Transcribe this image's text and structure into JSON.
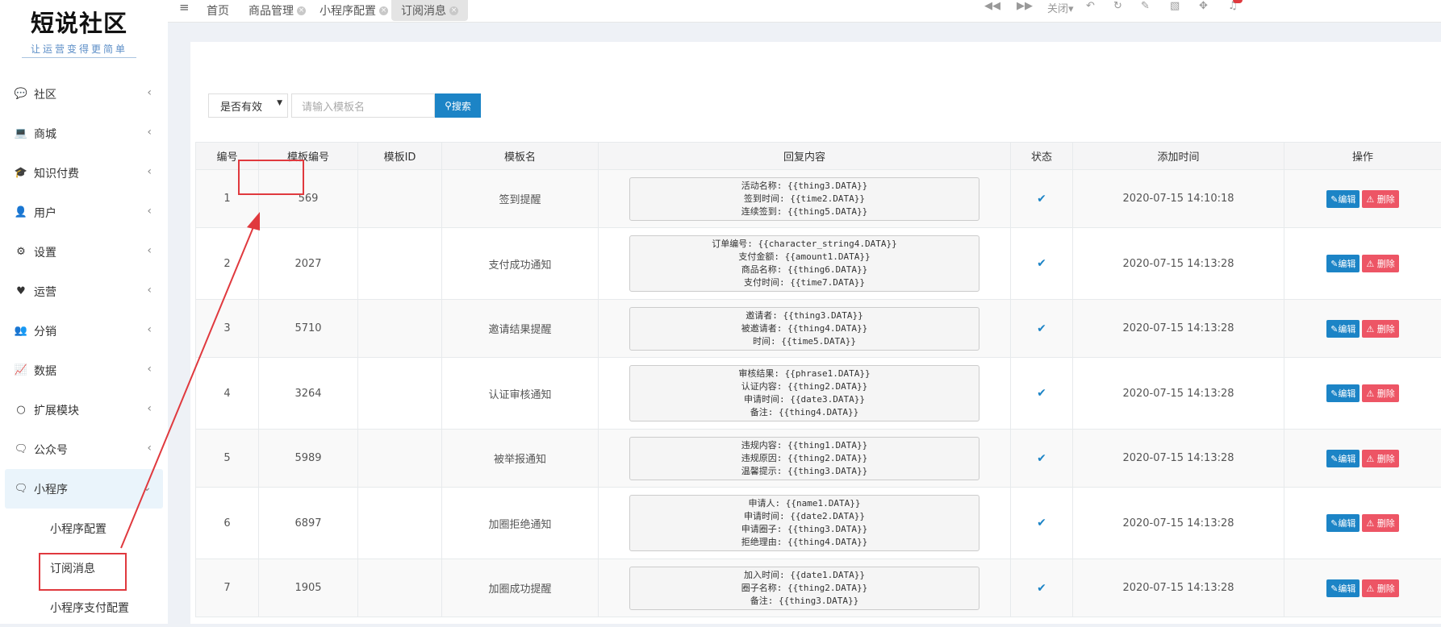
{
  "logo": {
    "title": "短说社区",
    "subtitle": "让运营变得更简单"
  },
  "sidebar": {
    "items": [
      {
        "label": "社区",
        "icon": "chat-icon"
      },
      {
        "label": "商城",
        "icon": "laptop-icon"
      },
      {
        "label": "知识付费",
        "icon": "graduation-cap-icon"
      },
      {
        "label": "用户",
        "icon": "user-icon"
      },
      {
        "label": "设置",
        "icon": "gear-icon"
      },
      {
        "label": "运营",
        "icon": "heartbeat-icon"
      },
      {
        "label": "分销",
        "icon": "users-icon"
      },
      {
        "label": "数据",
        "icon": "line-chart-icon"
      },
      {
        "label": "扩展模块",
        "icon": "puzzle-icon"
      },
      {
        "label": "公众号",
        "icon": "wechat-icon"
      },
      {
        "label": "小程序",
        "icon": "wechat-icon"
      }
    ],
    "submenu": [
      "小程序配置",
      "订阅消息",
      "小程序支付配置"
    ]
  },
  "tabs": [
    {
      "label": "首页"
    },
    {
      "label": "商品管理"
    },
    {
      "label": "小程序配置"
    },
    {
      "label": "订阅消息"
    }
  ],
  "toolbar": {
    "close_label": "关闭"
  },
  "filter": {
    "select_value": "是否有效",
    "search_placeholder": "请输入模板名",
    "search_label": "搜索"
  },
  "table": {
    "headers": [
      "编号",
      "模板编号",
      "模板ID",
      "模板名",
      "回复内容",
      "状态",
      "添加时间",
      "操作"
    ],
    "edit_label": "编辑",
    "delete_label": "删除",
    "rows": [
      {
        "no": "1",
        "code": "569",
        "id": "",
        "name": "签到提醒",
        "reply": [
          "活动名称: {{thing3.DATA}}",
          "签到时间: {{time2.DATA}}",
          "连续签到: {{thing5.DATA}}"
        ],
        "time": "2020-07-15 14:10:18"
      },
      {
        "no": "2",
        "code": "2027",
        "id": "",
        "name": "支付成功通知",
        "reply": [
          "订单编号: {{character_string4.DATA}}",
          "支付金额: {{amount1.DATA}}",
          "商品名称: {{thing6.DATA}}",
          "支付时间: {{time7.DATA}}"
        ],
        "time": "2020-07-15 14:13:28"
      },
      {
        "no": "3",
        "code": "5710",
        "id": "",
        "name": "邀请结果提醒",
        "reply": [
          "邀请者: {{thing3.DATA}}",
          "被邀请者: {{thing4.DATA}}",
          "时间: {{time5.DATA}}"
        ],
        "time": "2020-07-15 14:13:28"
      },
      {
        "no": "4",
        "code": "3264",
        "id": "",
        "name": "认证审核通知",
        "reply": [
          "审核结果: {{phrase1.DATA}}",
          "认证内容: {{thing2.DATA}}",
          "申请时间: {{date3.DATA}}",
          "备注: {{thing4.DATA}}"
        ],
        "time": "2020-07-15 14:13:28"
      },
      {
        "no": "5",
        "code": "5989",
        "id": "",
        "name": "被举报通知",
        "reply": [
          "违规内容: {{thing1.DATA}}",
          "违规原因: {{thing2.DATA}}",
          "温馨提示: {{thing3.DATA}}"
        ],
        "time": "2020-07-15 14:13:28"
      },
      {
        "no": "6",
        "code": "6897",
        "id": "",
        "name": "加圈拒绝通知",
        "reply": [
          "申请人: {{name1.DATA}}",
          "申请时间: {{date2.DATA}}",
          "申请圈子: {{thing3.DATA}}",
          "拒绝理由: {{thing4.DATA}}"
        ],
        "time": "2020-07-15 14:13:28"
      },
      {
        "no": "7",
        "code": "1905",
        "id": "",
        "name": "加圈成功提醒",
        "reply": [
          "加入时间: {{date1.DATA}}",
          "圈子名称: {{thing2.DATA}}",
          "备注: {{thing3.DATA}}"
        ],
        "time": "2020-07-15 14:13:28"
      }
    ]
  }
}
